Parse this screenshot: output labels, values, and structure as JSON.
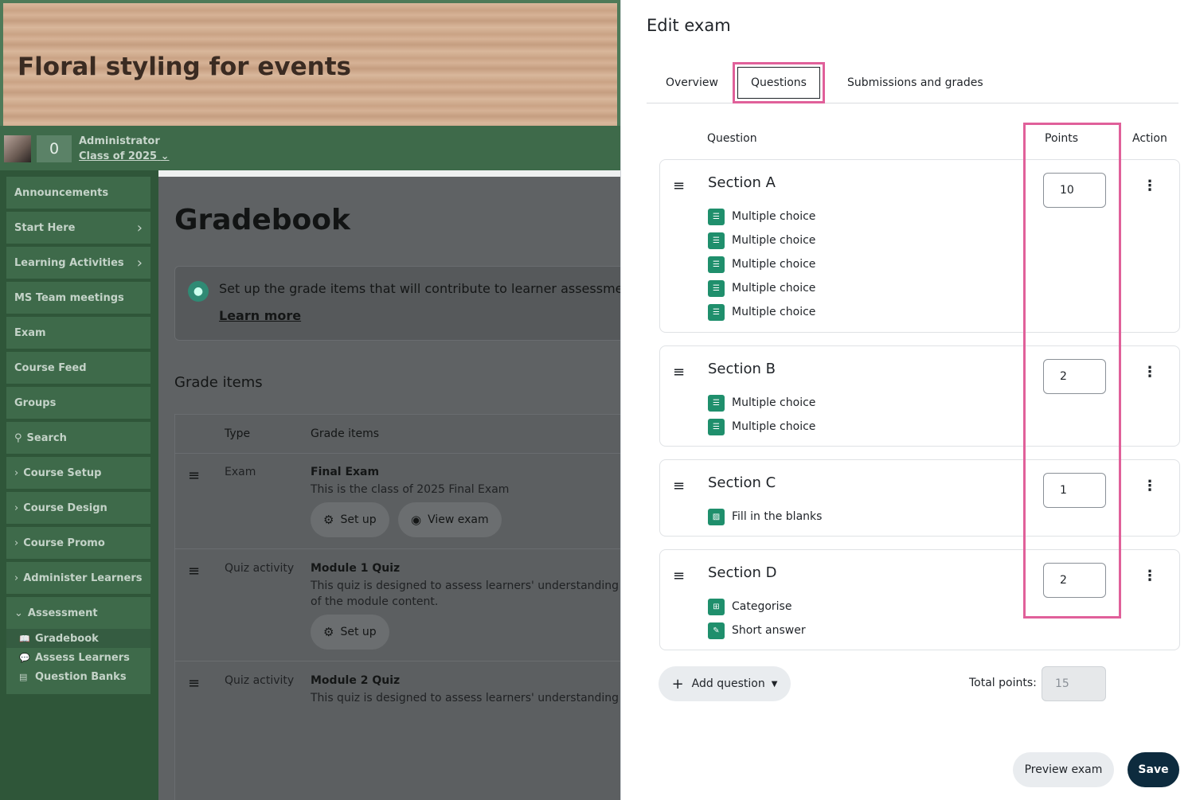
{
  "course": {
    "title": "Floral styling for events",
    "user_role": "Administrator",
    "user_class": "Class of 2025",
    "notification_count": "0"
  },
  "sidebar": {
    "items": [
      {
        "label": "Announcements"
      },
      {
        "label": "Start Here"
      },
      {
        "label": "Learning Activities"
      },
      {
        "label": "MS Team meetings"
      },
      {
        "label": "Exam"
      },
      {
        "label": "Course Feed"
      },
      {
        "label": "Groups"
      },
      {
        "label": "Search"
      },
      {
        "label": "Course Setup"
      },
      {
        "label": "Course Design"
      },
      {
        "label": "Course Promo"
      },
      {
        "label": "Administer Learners"
      },
      {
        "label": "Assessment"
      }
    ],
    "assessment_children": [
      {
        "label": "Gradebook"
      },
      {
        "label": "Assess Learners"
      },
      {
        "label": "Question Banks"
      }
    ]
  },
  "gradebook": {
    "title": "Gradebook",
    "info_text": "Set up the grade items that will contribute to learner assessment.",
    "info_link": "Learn more",
    "grade_items_heading": "Grade items",
    "columns": [
      "Type",
      "Grade items"
    ],
    "rows": [
      {
        "type": "Exam",
        "name": "Final Exam",
        "desc": "This is the class of 2025 Final Exam",
        "setup": "Set up",
        "view": "View exam"
      },
      {
        "type": "Quiz activity",
        "name": "Module 1 Quiz",
        "desc": "This quiz is designed to assess learners' understanding of the module content.",
        "setup": "Set up"
      },
      {
        "type": "Quiz activity",
        "name": "Module 2 Quiz",
        "desc": "This quiz is designed to assess learners' understanding of"
      }
    ]
  },
  "panel": {
    "title": "Edit exam",
    "tabs": [
      "Overview",
      "Questions",
      "Submissions and grades"
    ],
    "columns": {
      "question": "Question",
      "points": "Points",
      "action": "Action"
    },
    "sections": [
      {
        "title": "Section A",
        "points": "10",
        "questions": [
          "Multiple choice",
          "Multiple choice",
          "Multiple choice",
          "Multiple choice",
          "Multiple choice"
        ]
      },
      {
        "title": "Section B",
        "points": "2",
        "questions": [
          "Multiple choice",
          "Multiple choice"
        ]
      },
      {
        "title": "Section C",
        "points": "1",
        "questions": [
          "Fill in the blanks"
        ]
      },
      {
        "title": "Section D",
        "points": "2",
        "questions": [
          "Categorise",
          "Short answer"
        ]
      }
    ],
    "add_question": "Add question",
    "total_points_label": "Total points:",
    "total_points": "15",
    "preview_button": "Preview exam",
    "save_button": "Save"
  },
  "colors": {
    "highlight": "#e0609a",
    "save_button": "#0d2b3e",
    "question_icon": "#1f8f6c"
  }
}
